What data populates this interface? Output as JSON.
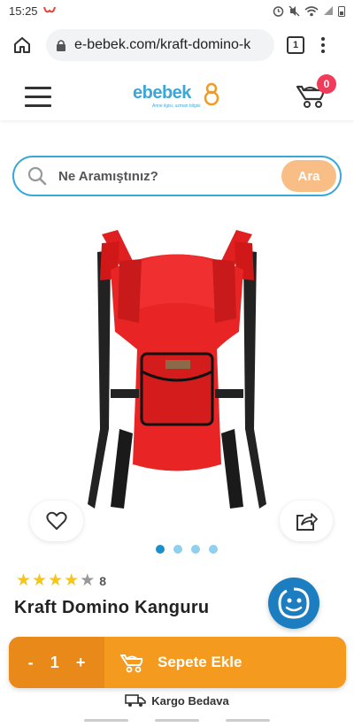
{
  "status_bar": {
    "time": "15:25"
  },
  "browser": {
    "url": "e-bebek.com/kraft-domino-k",
    "tab_count": "1"
  },
  "header": {
    "logo_text": "ebebek",
    "logo_tagline": "Anne ilgisi, uzman bilgisi",
    "cart_count": "0"
  },
  "search": {
    "placeholder": "Ne Aramıştınız?",
    "button_label": "Ara"
  },
  "product": {
    "title": "Kraft Domino Kanguru",
    "rating_stars_filled": 4,
    "rating_stars_total": 5,
    "review_count": "8",
    "image_count": 4,
    "active_image_index": 0
  },
  "buy_bar": {
    "minus": "-",
    "quantity": "1",
    "plus": "+",
    "add_to_cart_label": "Sepete Ekle"
  },
  "shipping": {
    "label": "Kargo Bedava"
  },
  "colors": {
    "brand_blue": "#3aa7d8",
    "accent_orange": "#f39a1f",
    "badge_red": "#f03b5b",
    "search_button": "#f9be86"
  }
}
